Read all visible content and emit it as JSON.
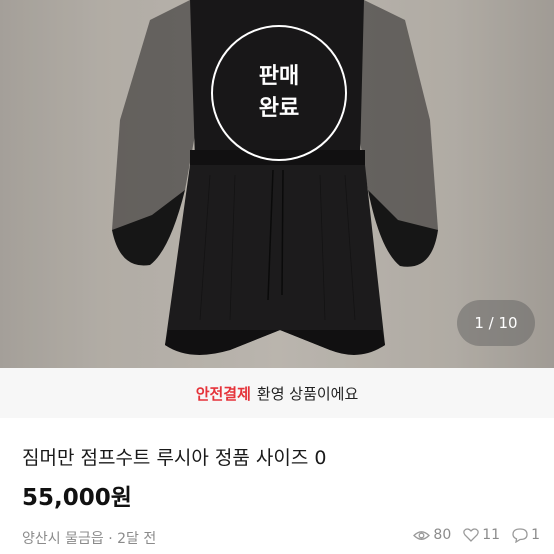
{
  "product_image": {
    "sold_badge": {
      "line1": "판매",
      "line2": "완료"
    },
    "page_indicator": "1 / 10",
    "subject": "black lace jumpsuit photo"
  },
  "safe_payment_banner": {
    "highlight": "안전결제",
    "message": "환영 상품이에요",
    "accent_color": "#e5333a"
  },
  "product": {
    "title": "짐머만 점프수트 루시아 정품 사이즈 0",
    "price": "55,000원"
  },
  "meta": {
    "location": "양산시 물금읍",
    "separator": "·",
    "time_ago": "2달 전"
  },
  "stats": {
    "views": "80",
    "likes": "11",
    "chats": "1",
    "icons": [
      "eye-icon",
      "heart-icon",
      "chat-icon"
    ]
  }
}
